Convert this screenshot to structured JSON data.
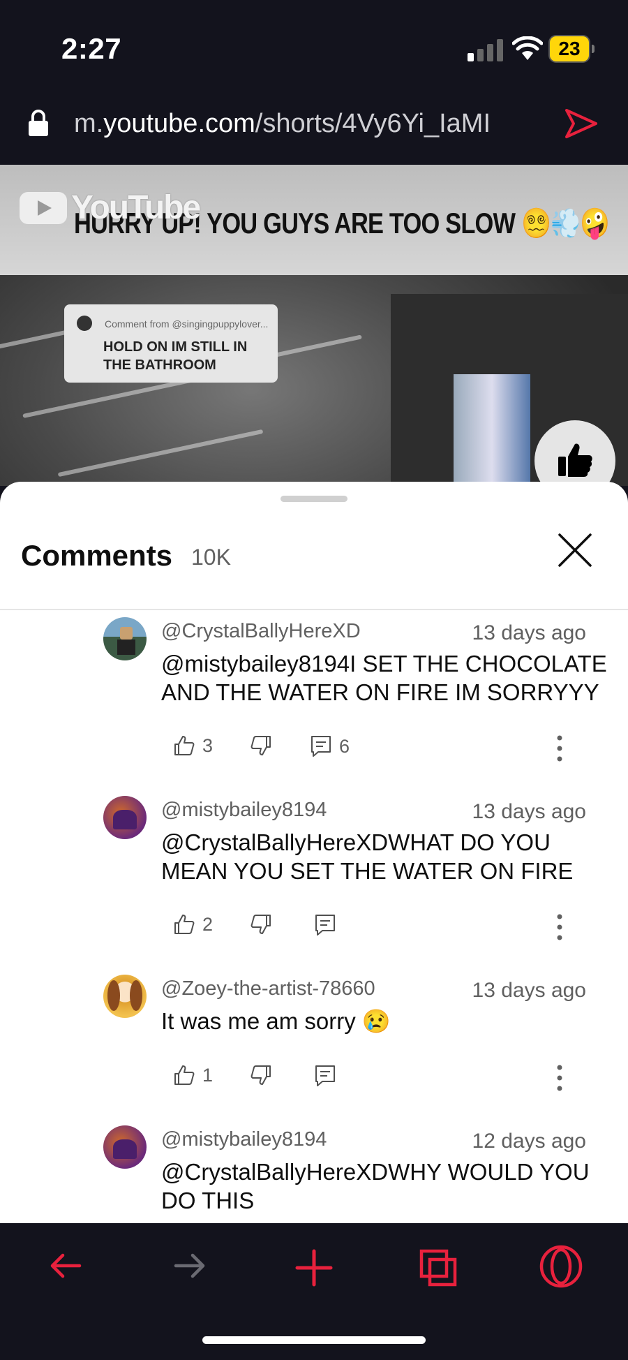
{
  "status_bar": {
    "time": "2:27",
    "battery": "23"
  },
  "browser": {
    "url_prefix": "m.",
    "url_domain": "youtube.com",
    "url_path": "/shorts/4Vy6Yi_IaMI",
    "accent_color": "#e8213d"
  },
  "video": {
    "logo_text": "YouTube",
    "caption": "HURRY UP! YOU GUYS ARE TOO SLOW 😵‍💫💨🤪",
    "bubble_from": "Comment from @singingpuppylover...",
    "bubble_text": "HOLD ON IM STILL IN THE BATHROOM"
  },
  "comments_panel": {
    "title": "Comments",
    "count": "10K",
    "comments": [
      {
        "author": "@CrystalBallyHereXD",
        "time": "13 days ago",
        "text": "@mistybailey8194I SET THE CHOCOLATE AND THE WATER ON FIRE IM SORRYYY",
        "likes": "3",
        "replies": "6",
        "avatar": "roblox-avatar"
      },
      {
        "author": "@mistybailey8194",
        "time": "13 days ago",
        "text": "@CrystalBallyHereXDWHAT DO YOU MEAN YOU SET THE WATER ON FIRE",
        "likes": "2",
        "replies": "",
        "avatar": "purple-art-avatar"
      },
      {
        "author": "@Zoey-the-artist-78660",
        "time": "13 days ago",
        "text": "It was me am sorry 😢",
        "likes": "1",
        "replies": "",
        "avatar": "drawn-girl-avatar"
      },
      {
        "author": "@mistybailey8194",
        "time": "12 days ago",
        "text": "@CrystalBallyHereXDWHY WOULD YOU DO THIS",
        "likes": "",
        "replies": "",
        "avatar": "purple-art-avatar"
      }
    ]
  },
  "bottom_nav": [
    "back-arrow-icon",
    "forward-arrow-icon",
    "new-tab-plus-icon",
    "tabs-icon",
    "opera-menu-icon"
  ]
}
